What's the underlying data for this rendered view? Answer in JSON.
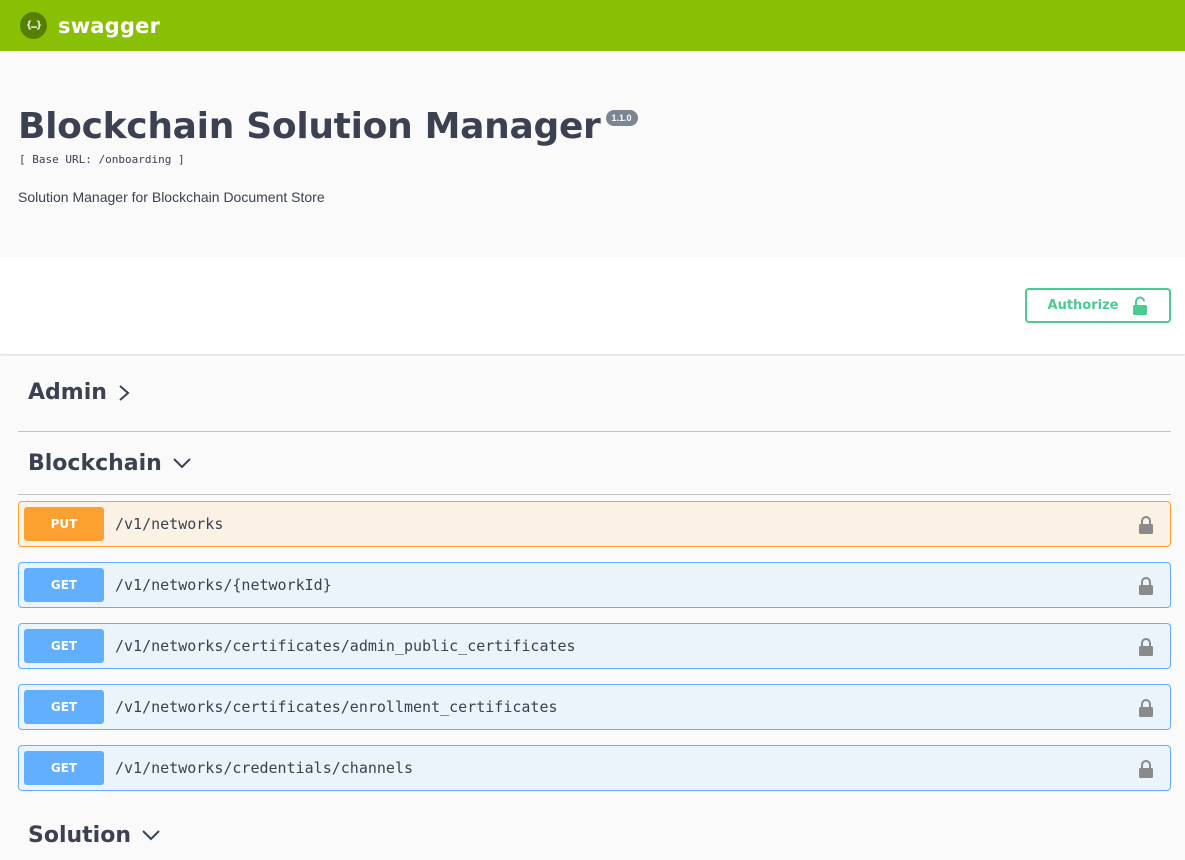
{
  "topbar": {
    "logo_glyph": "{…}",
    "logo_text": "swagger",
    "background": "#89bf04"
  },
  "info": {
    "title": "Blockchain Solution Manager",
    "version": "1.1.0",
    "base_url": "[ Base URL: /onboarding ]",
    "description": "Solution Manager for Blockchain Document Store"
  },
  "auth": {
    "authorize_label": "Authorize",
    "icon": "unlocked-padlock-icon",
    "color": "#49cc90"
  },
  "tags": [
    {
      "name": "Admin",
      "state": "collapsed"
    },
    {
      "name": "Blockchain",
      "state": "expanded",
      "operations": [
        {
          "method": "PUT",
          "path": "/v1/networks"
        },
        {
          "method": "GET",
          "path": "/v1/networks/{networkId}"
        },
        {
          "method": "GET",
          "path": "/v1/networks/certificates/admin_public_certificates"
        },
        {
          "method": "GET",
          "path": "/v1/networks/certificates/enrollment_certificates"
        },
        {
          "method": "GET",
          "path": "/v1/networks/credentials/channels"
        }
      ]
    },
    {
      "name": "Solution",
      "state": "expanded"
    }
  ],
  "colors": {
    "put": "#fca130",
    "get": "#61affe"
  }
}
